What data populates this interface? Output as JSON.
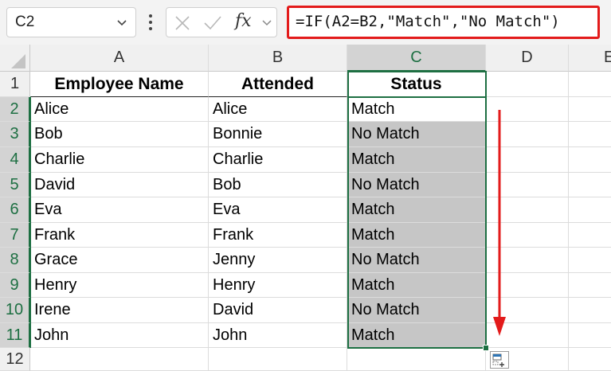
{
  "formula_bar": {
    "name_box": "C2",
    "fx_label": "fx",
    "formula": "=IF(A2=B2,\"Match\",\"No Match\")",
    "highlight_color": "#e31b1b"
  },
  "columns": [
    "A",
    "B",
    "C",
    "D",
    "E"
  ],
  "rows": [
    "1",
    "2",
    "3",
    "4",
    "5",
    "6",
    "7",
    "8",
    "9",
    "10",
    "11",
    "12"
  ],
  "headers": {
    "a": "Employee Name",
    "b": "Attended",
    "c": "Status"
  },
  "data": [
    {
      "name": "Alice",
      "attended": "Alice",
      "status": "Match"
    },
    {
      "name": "Bob",
      "attended": "Bonnie",
      "status": "No Match"
    },
    {
      "name": "Charlie",
      "attended": "Charlie",
      "status": "Match"
    },
    {
      "name": "David",
      "attended": "Bob",
      "status": "No Match"
    },
    {
      "name": "Eva",
      "attended": "Eva",
      "status": "Match"
    },
    {
      "name": "Frank",
      "attended": "Frank",
      "status": "Match"
    },
    {
      "name": "Grace",
      "attended": "Jenny",
      "status": "No Match"
    },
    {
      "name": "Henry",
      "attended": "Henry",
      "status": "Match"
    },
    {
      "name": "Irene",
      "attended": "David",
      "status": "No Match"
    },
    {
      "name": "John",
      "attended": "John",
      "status": "Match"
    }
  ],
  "colors": {
    "selection": "#1d6f42",
    "arrow": "#e31b1b",
    "selected_fill": "#c6c6c6"
  }
}
